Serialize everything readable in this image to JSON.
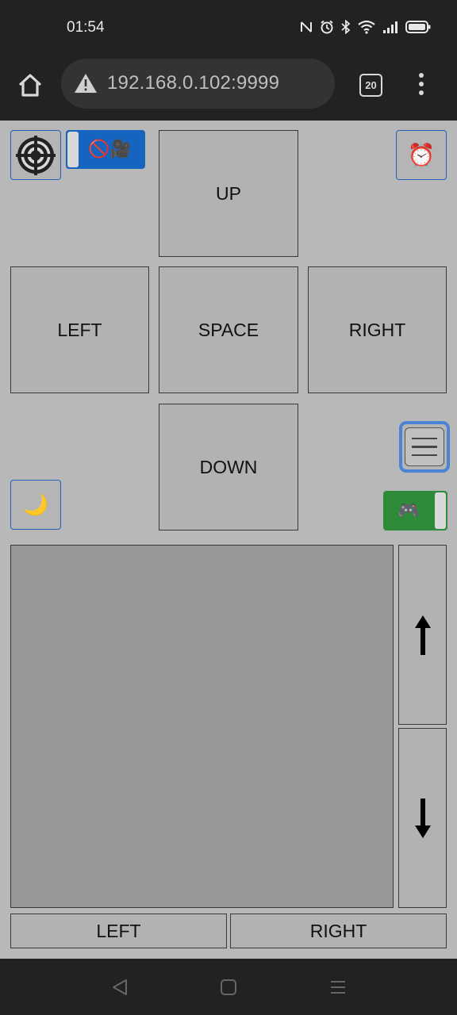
{
  "status_bar": {
    "time": "01:54",
    "icons": [
      "nfc-icon",
      "alarm-icon",
      "bluetooth-icon",
      "wifi-icon",
      "signal-icon",
      "battery-icon"
    ]
  },
  "browser": {
    "url": "192.168.0.102:9999",
    "tab_count": "20",
    "icons": [
      "home-icon",
      "warning-icon",
      "menu-dots-icon"
    ]
  },
  "controls": {
    "keys": {
      "up": "UP",
      "left": "LEFT",
      "space": "SPACE",
      "right": "RIGHT",
      "down": "DOWN"
    },
    "target_icon": "target-icon",
    "camera_toggle_icon": "🚫🎥",
    "alarm_icon": "⏰",
    "menu_icon": "hamburger-icon",
    "moon_icon": "🌙",
    "gamepad_toggle_icon": "🎮",
    "colors": {
      "camera_toggle": "#1565c0",
      "gamepad_toggle": "#2e8b3a",
      "accent_border": "#1f62b8"
    }
  },
  "touchpad": {
    "scroll_up_icon": "arrow-up-icon",
    "scroll_down_icon": "arrow-down-icon",
    "left_button": "LEFT",
    "right_button": "RIGHT"
  },
  "nav_bar": {
    "icons": [
      "back-icon",
      "home-square-icon",
      "recents-icon"
    ]
  }
}
